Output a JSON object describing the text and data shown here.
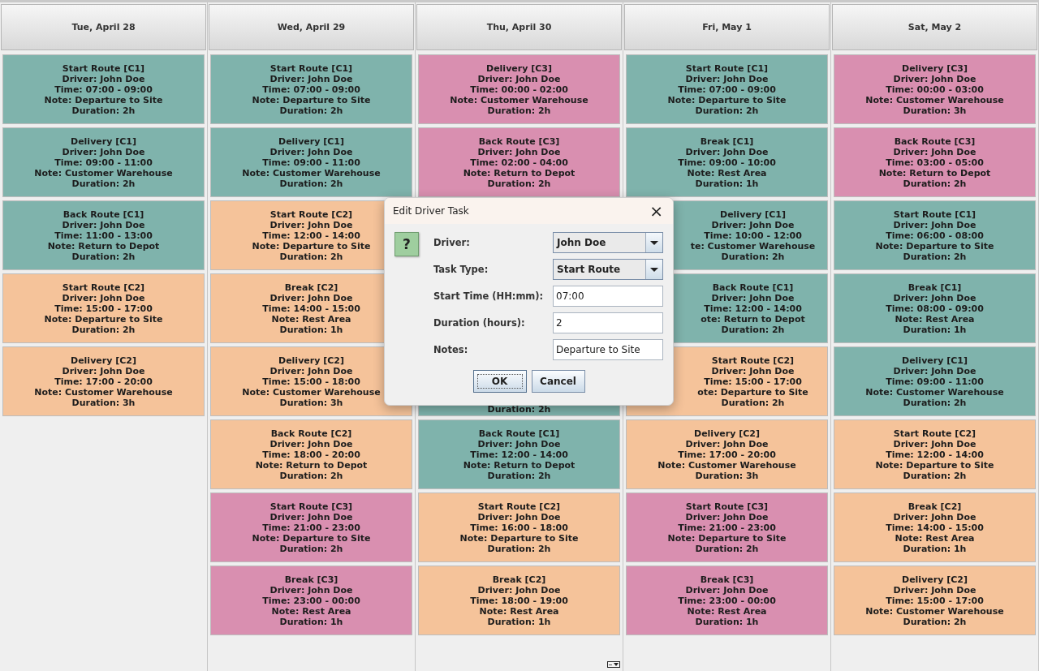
{
  "days": [
    {
      "header": "Tue, April 28",
      "cards": [
        {
          "kind": "task",
          "color": "#7fb3ac",
          "lines": [
            "Start Route [C1]",
            "Driver: John Doe",
            "Time: 07:00 - 09:00",
            "Note: Departure to Site",
            "Duration: 2h"
          ]
        },
        {
          "kind": "task",
          "color": "#7fb3ac",
          "lines": [
            "Delivery [C1]",
            "Driver: John Doe",
            "Time: 09:00 - 11:00",
            "Note: Customer Warehouse",
            "Duration: 2h"
          ]
        },
        {
          "kind": "task",
          "color": "#7fb3ac",
          "lines": [
            "Back Route [C1]",
            "Driver: John Doe",
            "Time: 11:00 - 13:00",
            "Note: Return to Depot",
            "Duration: 2h"
          ]
        },
        {
          "kind": "task",
          "color": "#f5c39a",
          "lines": [
            "Start Route [C2]",
            "Driver: John Doe",
            "Time: 15:00 - 17:00",
            "Note: Departure to Site",
            "Duration: 2h"
          ]
        },
        {
          "kind": "task",
          "color": "#f5c39a",
          "lines": [
            "Delivery [C2]",
            "Driver: John Doe",
            "Time: 17:00 - 20:00",
            "Note: Customer Warehouse",
            "Duration: 3h"
          ]
        }
      ]
    },
    {
      "header": "Wed, April 29",
      "cards": [
        {
          "kind": "task",
          "color": "#7fb3ac",
          "lines": [
            "Start Route [C1]",
            "Driver: John Doe",
            "Time: 07:00 - 09:00",
            "Note: Departure to Site",
            "Duration: 2h"
          ]
        },
        {
          "kind": "task",
          "color": "#7fb3ac",
          "lines": [
            "Delivery [C1]",
            "Driver: John Doe",
            "Time: 09:00 - 11:00",
            "Note: Customer Warehouse",
            "Duration: 2h"
          ]
        },
        {
          "kind": "task",
          "color": "#f5c39a",
          "lines": [
            "Start Route [C2]",
            "Driver: John Doe",
            "Time: 12:00 - 14:00",
            "Note: Departure to Site",
            "Duration: 2h"
          ]
        },
        {
          "kind": "task",
          "color": "#f5c39a",
          "lines": [
            "Break [C2]",
            "Driver: John Doe",
            "Time: 14:00 - 15:00",
            "Note: Rest Area",
            "Duration: 1h"
          ]
        },
        {
          "kind": "task",
          "color": "#f5c39a",
          "lines": [
            "Delivery [C2]",
            "Driver: John Doe",
            "Time: 15:00 - 18:00",
            "Note: Customer Warehouse",
            "Duration: 3h"
          ]
        },
        {
          "kind": "task",
          "color": "#f5c39a",
          "lines": [
            "Back Route [C2]",
            "Driver: John Doe",
            "Time: 18:00 - 20:00",
            "Note: Return to Depot",
            "Duration: 2h"
          ]
        },
        {
          "kind": "task",
          "color": "#d98fb0",
          "lines": [
            "Start Route [C3]",
            "Driver: John Doe",
            "Time: 21:00 - 23:00",
            "Note: Departure to Site",
            "Duration: 2h"
          ]
        },
        {
          "kind": "task",
          "color": "#d98fb0",
          "lines": [
            "Break [C3]",
            "Driver: John Doe",
            "Time: 23:00 - 00:00",
            "Note: Rest Area",
            "Duration: 1h"
          ]
        }
      ]
    },
    {
      "header": "Thu, April 30",
      "cards": [
        {
          "kind": "task",
          "color": "#d98fb0",
          "lines": [
            "Delivery [C3]",
            "Driver: John Doe",
            "Time: 00:00 - 02:00",
            "Note: Customer Warehouse",
            "Duration: 2h"
          ]
        },
        {
          "kind": "task",
          "color": "#d98fb0",
          "lines": [
            "Back Route [C3]",
            "Driver: John Doe",
            "Time: 02:00 - 04:00",
            "Note: Return to Depot",
            "Duration: 2h"
          ]
        },
        {
          "kind": "covered"
        },
        {
          "kind": "covered"
        },
        {
          "kind": "bottom",
          "color": "#7fb3ac",
          "lines": [
            "Duration: 2h"
          ]
        },
        {
          "kind": "task",
          "color": "#7fb3ac",
          "lines": [
            "Back Route [C1]",
            "Driver: John Doe",
            "Time: 12:00 - 14:00",
            "Note: Return to Depot",
            "Duration: 2h"
          ]
        },
        {
          "kind": "task",
          "color": "#f5c39a",
          "lines": [
            "Start Route [C2]",
            "Driver: John Doe",
            "Time: 16:00 - 18:00",
            "Note: Departure to Site",
            "Duration: 2h"
          ]
        },
        {
          "kind": "task",
          "color": "#f5c39a",
          "lines": [
            "Break [C2]",
            "Driver: John Doe",
            "Time: 18:00 - 19:00",
            "Note: Rest Area",
            "Duration: 1h"
          ]
        }
      ]
    },
    {
      "header": "Fri, May 1",
      "cards": [
        {
          "kind": "task",
          "color": "#7fb3ac",
          "lines": [
            "Start Route [C1]",
            "Driver: John Doe",
            "Time: 07:00 - 09:00",
            "Note: Departure to Site",
            "Duration: 2h"
          ]
        },
        {
          "kind": "task",
          "color": "#7fb3ac",
          "lines": [
            "Break [C1]",
            "Driver: John Doe",
            "Time: 09:00 - 10:00",
            "Note: Rest Area",
            "Duration: 1h"
          ]
        },
        {
          "kind": "clipped",
          "color": "#7fb3ac",
          "lines": [
            "Delivery [C1]",
            "Driver: John Doe",
            "Time: 10:00 - 12:00",
            "te: Customer Warehouse",
            "Duration: 2h"
          ]
        },
        {
          "kind": "clipped",
          "color": "#7fb3ac",
          "lines": [
            "Back Route [C1]",
            "Driver: John Doe",
            "Time: 12:00 - 14:00",
            "ote: Return to Depot",
            "Duration: 2h"
          ]
        },
        {
          "kind": "clipped",
          "color": "#f5c39a",
          "lines": [
            "Start Route [C2]",
            "Driver: John Doe",
            "Time: 15:00 - 17:00",
            "ote: Departure to Site",
            "Duration: 2h"
          ]
        },
        {
          "kind": "task",
          "color": "#f5c39a",
          "lines": [
            "Delivery [C2]",
            "Driver: John Doe",
            "Time: 17:00 - 20:00",
            "Note: Customer Warehouse",
            "Duration: 3h"
          ]
        },
        {
          "kind": "task",
          "color": "#d98fb0",
          "lines": [
            "Start Route [C3]",
            "Driver: John Doe",
            "Time: 21:00 - 23:00",
            "Note: Departure to Site",
            "Duration: 2h"
          ]
        },
        {
          "kind": "task",
          "color": "#d98fb0",
          "lines": [
            "Break [C3]",
            "Driver: John Doe",
            "Time: 23:00 - 00:00",
            "Note: Rest Area",
            "Duration: 1h"
          ]
        }
      ]
    },
    {
      "header": "Sat, May 2",
      "cards": [
        {
          "kind": "task",
          "color": "#d98fb0",
          "lines": [
            "Delivery [C3]",
            "Driver: John Doe",
            "Time: 00:00 - 03:00",
            "Note: Customer Warehouse",
            "Duration: 3h"
          ]
        },
        {
          "kind": "task",
          "color": "#d98fb0",
          "lines": [
            "Back Route [C3]",
            "Driver: John Doe",
            "Time: 03:00 - 05:00",
            "Note: Return to Depot",
            "Duration: 2h"
          ]
        },
        {
          "kind": "task",
          "color": "#7fb3ac",
          "lines": [
            "Start Route [C1]",
            "Driver: John Doe",
            "Time: 06:00 - 08:00",
            "Note: Departure to Site",
            "Duration: 2h"
          ]
        },
        {
          "kind": "task",
          "color": "#7fb3ac",
          "lines": [
            "Break [C1]",
            "Driver: John Doe",
            "Time: 08:00 - 09:00",
            "Note: Rest Area",
            "Duration: 1h"
          ]
        },
        {
          "kind": "task",
          "color": "#7fb3ac",
          "lines": [
            "Delivery [C1]",
            "Driver: John Doe",
            "Time: 09:00 - 11:00",
            "Note: Customer Warehouse",
            "Duration: 2h"
          ]
        },
        {
          "kind": "task",
          "color": "#f5c39a",
          "lines": [
            "Start Route [C2]",
            "Driver: John Doe",
            "Time: 12:00 - 14:00",
            "Note: Departure to Site",
            "Duration: 2h"
          ]
        },
        {
          "kind": "task",
          "color": "#f5c39a",
          "lines": [
            "Break [C2]",
            "Driver: John Doe",
            "Time: 14:00 - 15:00",
            "Note: Rest Area",
            "Duration: 1h"
          ]
        },
        {
          "kind": "task",
          "color": "#f5c39a",
          "lines": [
            "Delivery [C2]",
            "Driver: John Doe",
            "Time: 15:00 - 17:00",
            "Note: Customer Warehouse",
            "Duration: 2h"
          ]
        }
      ]
    }
  ],
  "dialog": {
    "title": "Edit Driver Task",
    "close": "×",
    "icon": "?",
    "fields": [
      {
        "label": "Driver:",
        "kind": "select",
        "value": "John Doe"
      },
      {
        "label": "Task Type:",
        "kind": "select",
        "value": "Start Route"
      },
      {
        "label": "Start Time (HH:mm):",
        "kind": "text",
        "value": "07:00"
      },
      {
        "label": "Duration (hours):",
        "kind": "text",
        "value": "2"
      },
      {
        "label": "Notes:",
        "kind": "text",
        "value": "Departure to Site"
      }
    ],
    "buttons": [
      {
        "label": "OK",
        "focused": true
      },
      {
        "label": "Cancel",
        "focused": false
      }
    ]
  }
}
